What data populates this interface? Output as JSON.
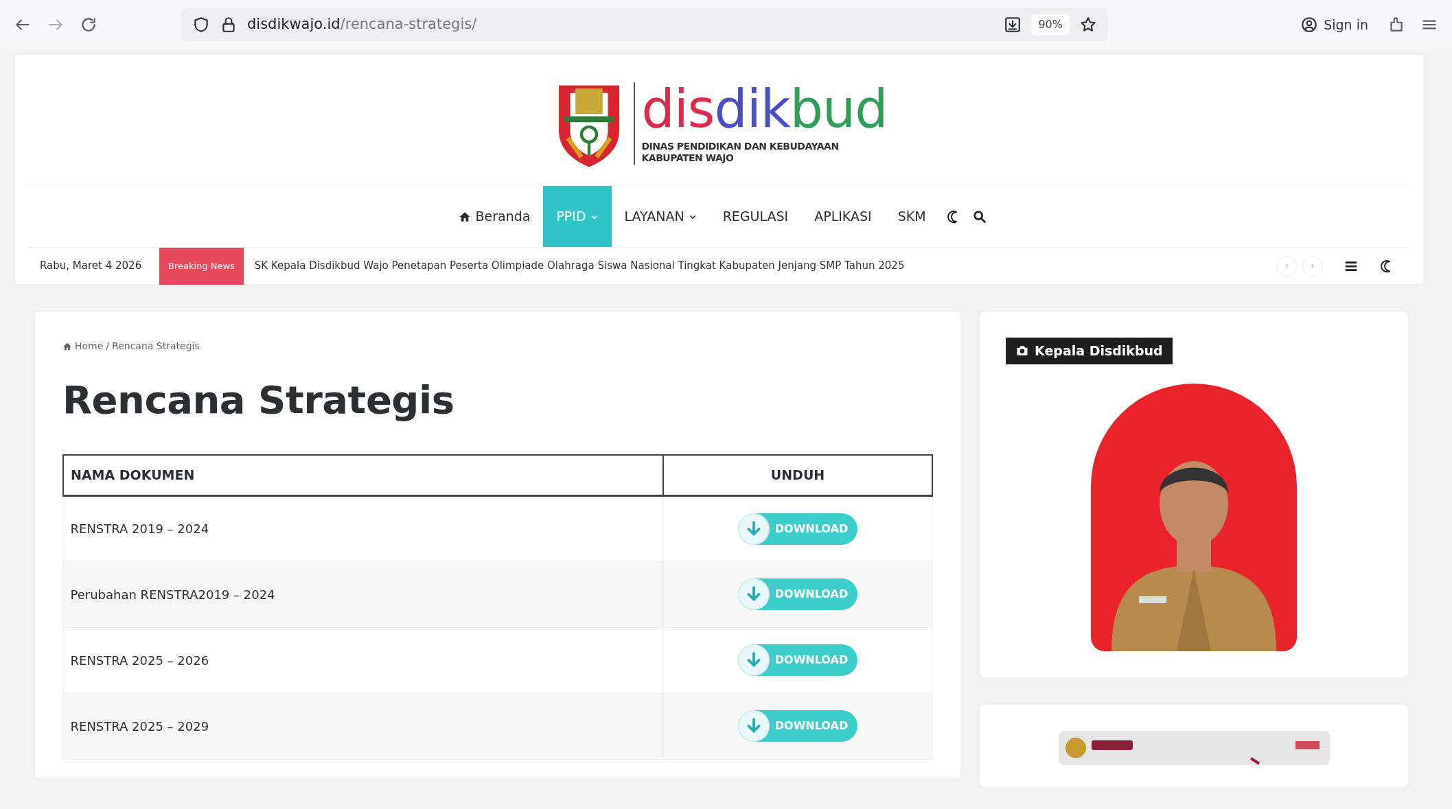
{
  "browser": {
    "url_host": "disdikwajo.id",
    "url_path": "/rencana-strategis/",
    "zoom": "90%",
    "sign_in": "Sign in"
  },
  "logo": {
    "parts": [
      {
        "text": "dis",
        "color": "#e0284a"
      },
      {
        "text": "dik",
        "color": "#4a4fc4"
      },
      {
        "text": "bud",
        "color": "#2e9e5a"
      }
    ],
    "subtitle": [
      "DINAS PENDIDIKAN DAN KEBUDAYAAN",
      "KABUPATEN WAJO"
    ]
  },
  "nav": [
    {
      "label": "Beranda",
      "kind": "home",
      "dropdown": false,
      "selected": false
    },
    {
      "label": "PPID",
      "dropdown": true,
      "selected": true
    },
    {
      "label": "LAYANAN",
      "dropdown": true,
      "selected": false
    },
    {
      "label": "REGULASI",
      "dropdown": false,
      "selected": false
    },
    {
      "label": "APLIKASI",
      "dropdown": false,
      "selected": false
    },
    {
      "label": "SKM",
      "dropdown": false,
      "selected": false
    }
  ],
  "ticker": {
    "date": "Rabu, Maret 4 2026",
    "badge": "Breaking News",
    "headline": "SK Kepala Disdikbud Wajo Penetapan Peserta Olimpiade Olahraga Siswa Nasional Tingkat Kabupaten Jenjang SMP Tahun 2025",
    "prev": "‹",
    "next": "›"
  },
  "breadcrumb": [
    "Home",
    "/",
    "Rencana Strategis"
  ],
  "title": "Rencana Strategis",
  "table": {
    "columns": [
      "NAMA DOKUMEN",
      "UNDUH"
    ],
    "rows": [
      {
        "name": "RENSTRA 2019 – 2024",
        "button": "DOWNLOAD"
      },
      {
        "name": "Perubahan RENSTRA2019 – 2024",
        "button": "DOWNLOAD"
      },
      {
        "name": "RENSTRA 2025 – 2026",
        "button": "DOWNLOAD"
      },
      {
        "name": "RENSTRA 2025 – 2029",
        "button": "DOWNLOAD"
      }
    ]
  },
  "sidebar": {
    "widget_title": "Kepala Disdikbud"
  }
}
